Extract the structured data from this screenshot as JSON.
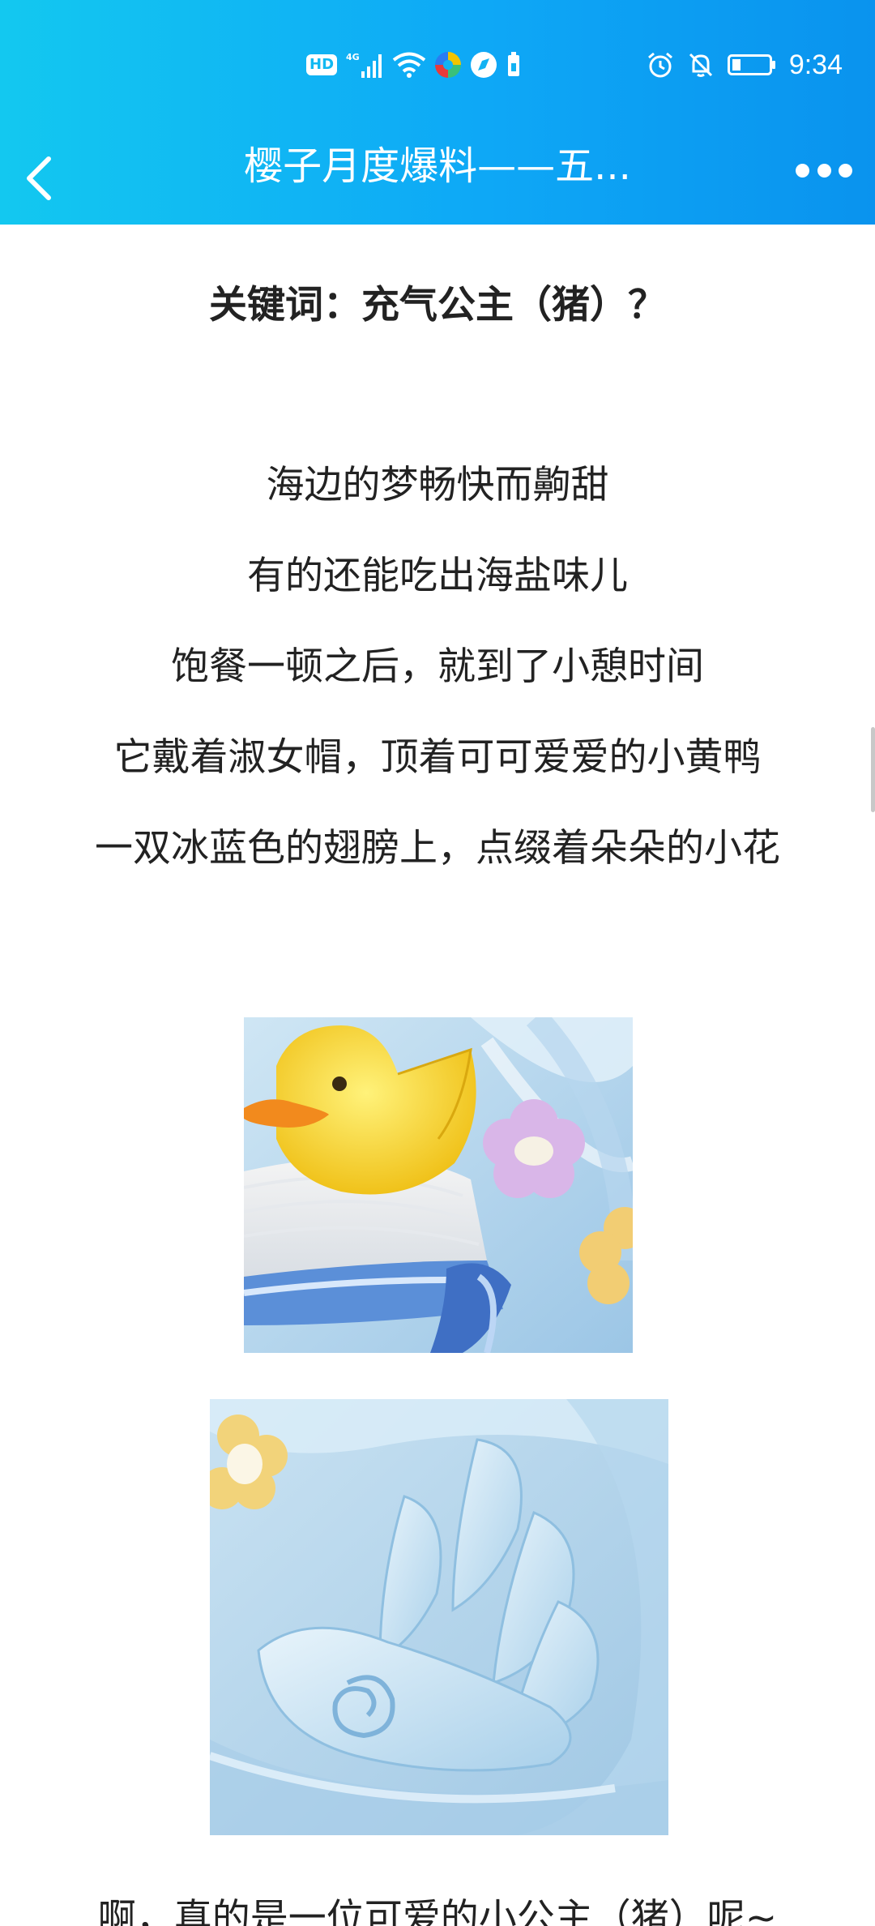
{
  "status_bar": {
    "left_icons": [
      "hd-icon",
      "4g-signal-icon",
      "wifi-icon",
      "app-color-icon",
      "app-compass-icon",
      "sim-card-icon"
    ],
    "hd_label": "HD",
    "network_label": "4G",
    "right_icons": [
      "alarm-icon",
      "mute-bell-icon",
      "battery-icon"
    ],
    "time": "9:34"
  },
  "nav": {
    "title": "樱子月度爆料——五...",
    "back_icon": "chevron-left-icon",
    "more_icon": "more-dots-icon"
  },
  "article": {
    "keyword_title": "关键词：充气公主（猪）？",
    "poem_lines": [
      "海边的梦畅快而齁甜",
      "有的还能吃出海盐味儿",
      "饱餐一顿之后，就到了小憩时间",
      "它戴着淑女帽，顶着可可爱爱的小黄鸭",
      "一双冰蓝色的翅膀上，点缀着朵朵的小花"
    ],
    "images": [
      {
        "name": "duck-hat-image",
        "description_icon": "duck-hat-illustration"
      },
      {
        "name": "wing-image",
        "description_icon": "wing-illustration"
      }
    ],
    "closing_line": "啊，真的是一位可爱的小公主（猪）呢~"
  },
  "colors": {
    "header_start": "#13c8f0",
    "header_end": "#0a93ee",
    "text": "#222222",
    "background": "#ffffff"
  }
}
